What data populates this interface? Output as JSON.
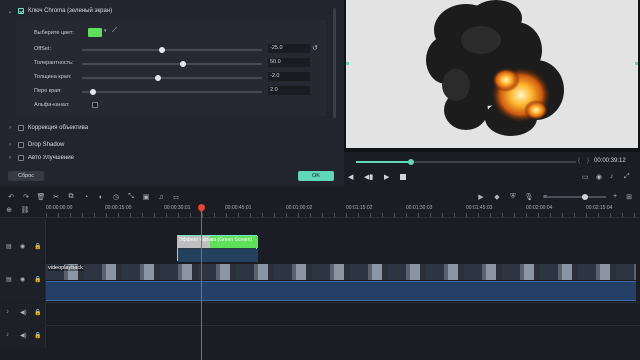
{
  "effect_panel": {
    "section_chroma": "Ключ Chroma (зеленый экран)",
    "choose_color_label": "Выберите цвет:",
    "key_color": "#5ee05a",
    "params": [
      {
        "label": "OffSet:",
        "value": "-25.0",
        "slider_fraction": 0.44
      },
      {
        "label": "Толерантность:",
        "value": "50.0",
        "slider_fraction": 0.56
      },
      {
        "label": "Толщина края:",
        "value": "-2.0",
        "slider_fraction": 0.42
      },
      {
        "label": "Перо края:",
        "value": "2.0",
        "slider_fraction": 0.06
      }
    ],
    "alpha_label": "Альфа-канал:",
    "section_lens": "Коррекция объектива",
    "section_shadow": "Drop Shadow",
    "section_auto": "Авто Улучшение",
    "reset_label": "Сброс",
    "ok_label": "OK"
  },
  "player": {
    "progress_fraction": 0.25,
    "timecode": "00:00:39:12",
    "brace_left": "{",
    "brace_right": "}"
  },
  "timeline": {
    "ruler": [
      "00:00:00:00",
      "00:00:15:00",
      "00:00:30:01",
      "00:00:45:01",
      "00:01:00:02",
      "00:01:15:02",
      "00:01:30:03",
      "00:01:45:03",
      "00:02:00:04",
      "00:02:15:04"
    ],
    "effect_clip_label": "Эффект взрыва (Green Screen)",
    "video_clip_label": "videoplayback",
    "playhead_color": "#e0453a",
    "accent": "#5fd7b8"
  }
}
